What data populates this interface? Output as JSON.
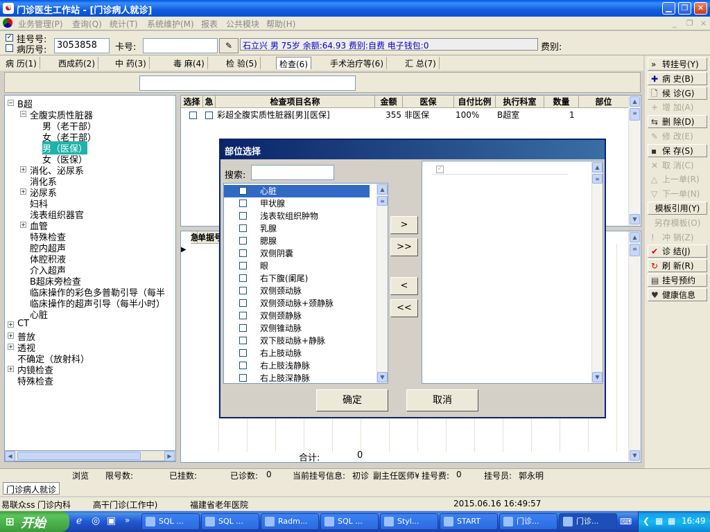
{
  "window": {
    "title": "门诊医生工作站 - [门诊病人就诊]"
  },
  "menu": [
    "业务管理(P)",
    "查询(Q)",
    "统计(T)",
    "系统维护(M)",
    "报表",
    "公共模块",
    "帮助(H)"
  ],
  "patient": {
    "reg_label": "挂号号:",
    "record_label": "病历号:",
    "record_no": "3053858",
    "card_label": "卡号:",
    "card_value": "",
    "info": "石立兴 男 75岁 余额:64.93 费别:自费 电子钱包:0",
    "fee_label": "费别:"
  },
  "tabs": [
    "病 历(1)",
    "西成药(2)",
    "中 药(3)",
    "毒 麻(4)",
    "检 验(5)",
    "检查(6)",
    "手术治疗等(6)",
    "汇 总(7)"
  ],
  "tree": [
    {
      "label": "B超",
      "level": 0,
      "exp": "−"
    },
    {
      "label": "全腹实质性脏器",
      "level": 1,
      "exp": "−"
    },
    {
      "label": "男（老干部）",
      "level": 2
    },
    {
      "label": "女（老干部）",
      "level": 2
    },
    {
      "label": "男（医保）",
      "level": 2,
      "selected": true
    },
    {
      "label": "女（医保）",
      "level": 2
    },
    {
      "label": "消化、泌尿系",
      "level": 1,
      "exp": "+"
    },
    {
      "label": "消化系",
      "level": 1
    },
    {
      "label": "泌尿系",
      "level": 1,
      "exp": "+"
    },
    {
      "label": "妇科",
      "level": 1
    },
    {
      "label": "浅表组织器官",
      "level": 1
    },
    {
      "label": "血管",
      "level": 1,
      "exp": "+"
    },
    {
      "label": "特殊检查",
      "level": 1
    },
    {
      "label": "腔内超声",
      "level": 1
    },
    {
      "label": "体腔积液",
      "level": 1
    },
    {
      "label": "介入超声",
      "level": 1
    },
    {
      "label": "B超床旁检查",
      "level": 1
    },
    {
      "label": "临床操作的彩色多普勒引导（每半",
      "level": 1
    },
    {
      "label": "临床操作的超声引导（每半小时）",
      "level": 1
    },
    {
      "label": "心脏",
      "level": 1
    },
    {
      "label": "CT",
      "level": 0,
      "exp": "+"
    },
    {
      "label": "普放",
      "level": 0,
      "exp": "+"
    },
    {
      "label": "透视",
      "level": 0,
      "exp": "+"
    },
    {
      "label": "不确定（放射科）",
      "level": 0
    },
    {
      "label": "内镜检查",
      "level": 0,
      "exp": "+"
    },
    {
      "label": "特殊检查",
      "level": 0
    }
  ],
  "grid": {
    "headers": [
      "选择",
      "急",
      "检查项目名称",
      "金额",
      "医保",
      "自付比例",
      "执行科室",
      "数量",
      "部位"
    ],
    "rows": [
      {
        "name": "彩超全腹实质性脏器[男][医保]",
        "amount": "355",
        "insurance": "非医保",
        "ratio": "100%",
        "dept": "B超室",
        "qty": "1",
        "part": ""
      }
    ]
  },
  "grid2": {
    "h1": "急",
    "h2": "单据号",
    "total_label": "合计:",
    "total": "0"
  },
  "right_buttons": [
    {
      "label": "转挂号(Y)",
      "icon": "double-arrow-icon",
      "dis": false
    },
    {
      "label": "病  史(B)",
      "icon": "plus-icon",
      "dis": false
    },
    {
      "label": "候  诊(G)",
      "icon": "doc-icon",
      "dis": false
    },
    {
      "label": "增  加(A)",
      "icon": "add-icon",
      "dis": true
    },
    {
      "label": "删  除(D)",
      "icon": "delete-icon",
      "dis": false
    },
    {
      "label": "修  改(E)",
      "icon": "edit-icon",
      "dis": true
    },
    {
      "label": "保  存(S)",
      "icon": "save-icon",
      "dis": false
    },
    {
      "label": "取  消(C)",
      "icon": "cancel-icon",
      "dis": true
    },
    {
      "label": "上一单(R)",
      "icon": "up-icon",
      "dis": true
    },
    {
      "label": "下一单(N)",
      "icon": "down-icon",
      "dis": true
    },
    {
      "label": "模板引用(Y)",
      "icon": "",
      "dis": false
    },
    {
      "label": "另存模板(O)",
      "icon": "",
      "dis": true
    },
    {
      "label": "冲  销(Z)",
      "icon": "excl-icon",
      "dis": true
    },
    {
      "label": "诊  结(J)",
      "icon": "check-icon",
      "dis": false
    },
    {
      "label": "刷  新(R)",
      "icon": "refresh-icon",
      "dis": false
    },
    {
      "label": "挂号预约",
      "icon": "book-icon",
      "dis": false
    },
    {
      "label": "健康信息",
      "icon": "health-icon",
      "dis": false
    }
  ],
  "status1": {
    "browse": "浏览",
    "limit_label": "限号数:",
    "registered_label": "已挂数:",
    "diagnosed_label": "已诊数:",
    "diagnosed": "0",
    "current_label": "当前挂号信息:",
    "visit": "初诊",
    "doctor_title": "副主任医师¥",
    "fee_label": "挂号费:",
    "fee": "0",
    "clerk_label": "挂号员:",
    "clerk": "郭永明"
  },
  "window_tab": "门诊病人就诊",
  "status2": {
    "user": "易联众ss",
    "dept": "门诊内科",
    "clinic": "高干门诊(工作中)",
    "hospital": "福建省老年医院",
    "datetime": "2015.06.16 16:49:57"
  },
  "taskbar": {
    "start": "开始",
    "tasks": [
      "SQL ...",
      "SQL ...",
      "Radm...",
      "SQL ...",
      "Styl...",
      "START",
      "门诊...",
      "门诊..."
    ],
    "clock": "16:49"
  },
  "dialog": {
    "title": "部位选择",
    "search_label": "搜索:",
    "search_value": "",
    "items": [
      "心脏",
      "甲状腺",
      "浅表软组织肿物",
      "乳腺",
      "腮腺",
      "双侧阴囊",
      "眼",
      "右下腹(阑尾)",
      "双侧颈动脉",
      "双侧颈动脉+颈静脉",
      "双侧颈静脉",
      "双侧锥动脉",
      "双下肢动脉+静脉",
      "右上肢动脉",
      "右上肢浅静脉",
      "右上肢深静脉"
    ],
    "btn_add": ">",
    "btn_add_all": ">>",
    "btn_remove": "<",
    "btn_remove_all": "<<",
    "ok": "确定",
    "cancel": "取消"
  }
}
